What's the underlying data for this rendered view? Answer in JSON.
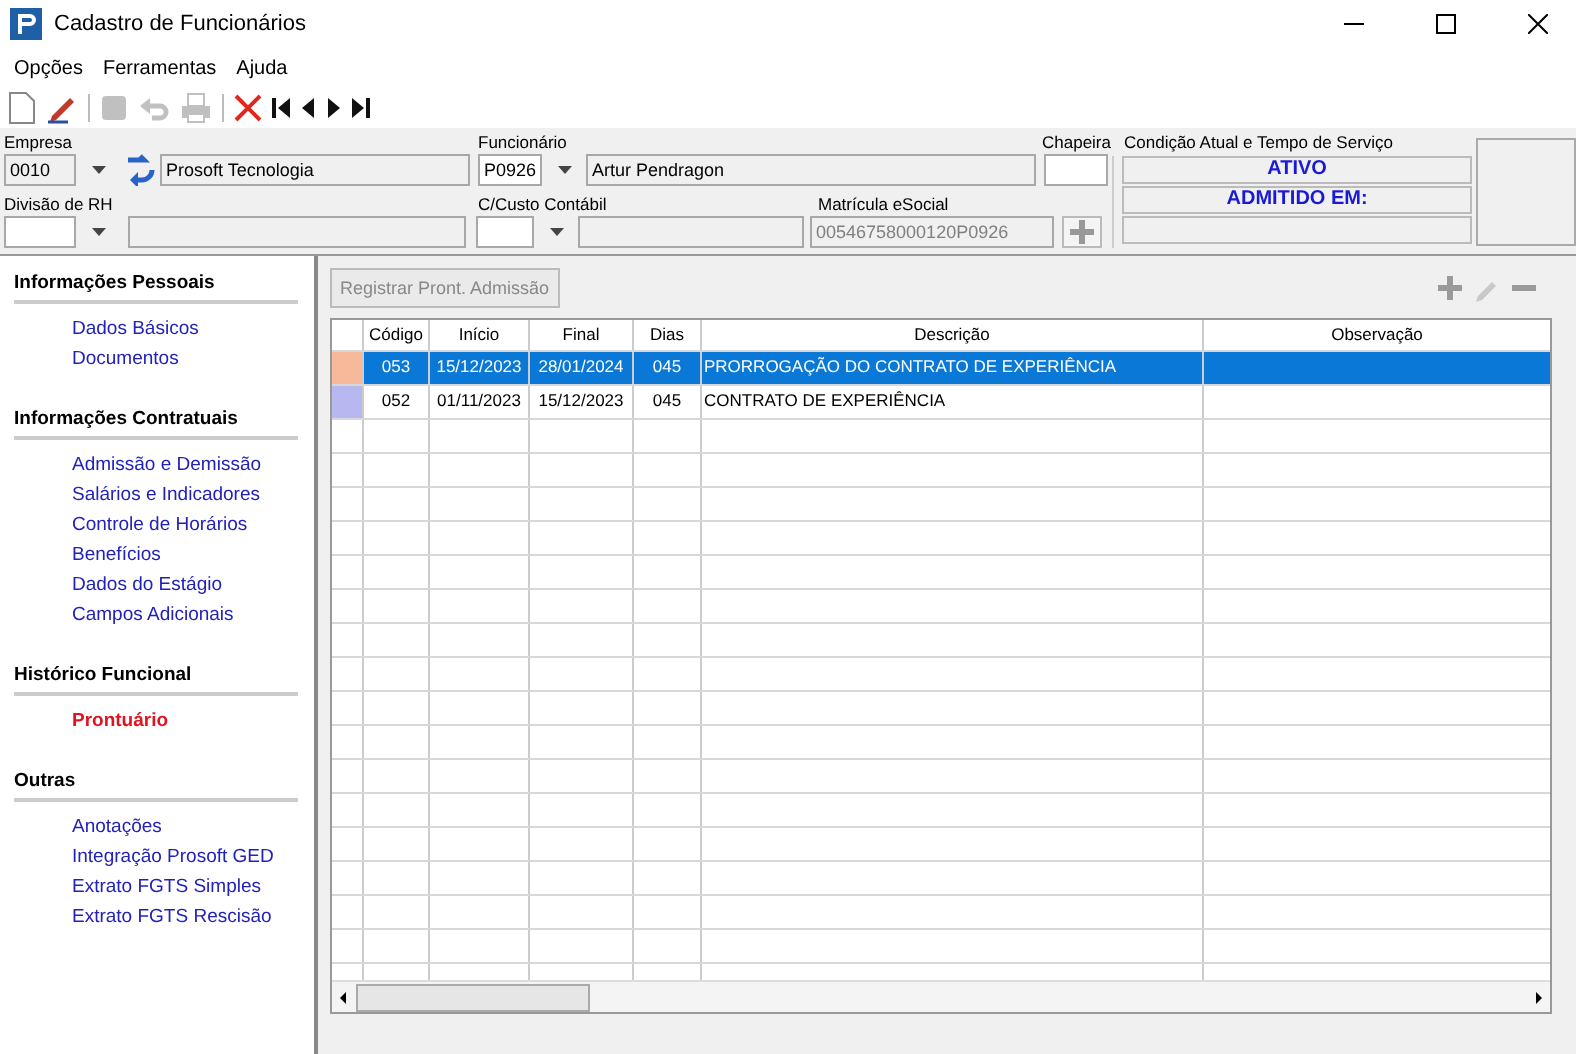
{
  "window": {
    "title": "Cadastro de Funcionários"
  },
  "menu": [
    {
      "label": "Opções"
    },
    {
      "label": "Ferramentas"
    },
    {
      "label": "Ajuda"
    }
  ],
  "toolbar": [
    {
      "kind": "new",
      "disabled": false
    },
    {
      "kind": "edit",
      "disabled": false
    },
    {
      "kind": "sep"
    },
    {
      "kind": "save",
      "disabled": true
    },
    {
      "kind": "undo",
      "disabled": true
    },
    {
      "kind": "print",
      "disabled": true
    },
    {
      "kind": "sep"
    },
    {
      "kind": "delete",
      "disabled": false
    },
    {
      "kind": "first",
      "disabled": false
    },
    {
      "kind": "prev",
      "disabled": false
    },
    {
      "kind": "next",
      "disabled": false
    },
    {
      "kind": "last",
      "disabled": false
    }
  ],
  "form": {
    "empresa": {
      "label": "Empresa",
      "code": "0010",
      "name": "Prosoft Tecnologia"
    },
    "funcionario": {
      "label": "Funcionário",
      "code": "P0926",
      "name": "Artur Pendragon"
    },
    "chapeira": {
      "label": "Chapeira"
    },
    "divisao": {
      "label": "Divisão de RH"
    },
    "ccusto": {
      "label": "C/Custo Contábil"
    },
    "matricula": {
      "label": "Matrícula eSocial",
      "value": "00546758000120P0926"
    },
    "condicao": {
      "label": "Condição Atual e Tempo de Serviço",
      "status": "ATIVO",
      "admitido": "ADMITIDO EM:"
    }
  },
  "sidebar": [
    {
      "title": "Informações Pessoais",
      "items": [
        {
          "label": "Dados Básicos",
          "selected": false
        },
        {
          "label": "Documentos",
          "selected": false
        }
      ]
    },
    {
      "title": "Informações Contratuais",
      "items": [
        {
          "label": "Admissão e Demissão",
          "selected": false
        },
        {
          "label": "Salários e Indicadores",
          "selected": false
        },
        {
          "label": "Controle de Horários",
          "selected": false
        },
        {
          "label": "Benefícios",
          "selected": false
        },
        {
          "label": "Dados do Estágio",
          "selected": false
        },
        {
          "label": "Campos Adicionais",
          "selected": false
        }
      ]
    },
    {
      "title": "Histórico Funcional",
      "items": [
        {
          "label": "Prontuário",
          "selected": true
        }
      ]
    },
    {
      "title": "Outras",
      "items": [
        {
          "label": "Anotações",
          "selected": false
        },
        {
          "label": "Integração Prosoft GED",
          "selected": false
        },
        {
          "label": "Extrato FGTS Simples",
          "selected": false
        },
        {
          "label": "Extrato FGTS Rescisão",
          "selected": false
        }
      ]
    }
  ],
  "register_button": {
    "label": "Registrar Pront. Admissão",
    "disabled": true
  },
  "table": {
    "columns": [
      "Código",
      "Início",
      "Final",
      "Dias",
      "Descrição",
      "Observação"
    ],
    "rows": [
      {
        "color": "#f8b89a",
        "selected": true,
        "cells": [
          "053",
          "15/12/2023",
          "28/01/2024",
          "045",
          "PRORROGAÇÃO DO CONTRATO DE EXPERIÊNCIA",
          ""
        ]
      },
      {
        "color": "#b8b8f0",
        "selected": false,
        "cells": [
          "052",
          "01/11/2023",
          "15/12/2023",
          "045",
          "CONTRATO DE EXPERIÊNCIA",
          ""
        ]
      }
    ]
  }
}
